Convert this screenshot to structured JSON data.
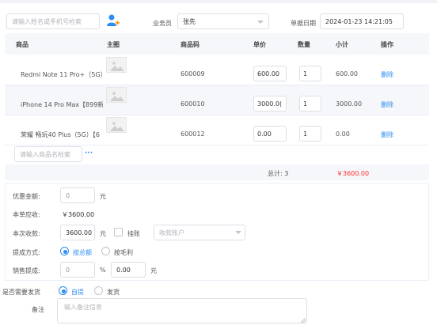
{
  "search": {
    "placeholder": "请输入姓名或手机号检索"
  },
  "header": {
    "salesperson_label": "业务员",
    "salesperson_value": "张先",
    "date_label": "单据日期",
    "date_value": "2024-01-23 14:21:05"
  },
  "table": {
    "columns": [
      "商品",
      "主图",
      "商品码",
      "单价",
      "数量",
      "小计",
      "操作"
    ],
    "rows": [
      {
        "name": "Redmi Note 11 Pro+（5G）",
        "code": "600009",
        "price": "600.00",
        "qty": "1",
        "subtotal": "600.00",
        "action": "删除"
      },
      {
        "name": "iPhone 14 Pro Max【899新",
        "code": "600010",
        "price": "3000.0(",
        "qty": "1",
        "subtotal": "3000.00",
        "action": "删除"
      },
      {
        "name": "荣耀 畅玩40 Plus（5G）【6",
        "code": "600012",
        "price": "0.00",
        "qty": "1",
        "subtotal": "0.00",
        "action": "删除"
      }
    ],
    "add_placeholder": "请输入商品名检索",
    "more": "···",
    "total_label": "总计: 3",
    "total_amount": "￥3600.00"
  },
  "form": {
    "discount_label": "优惠金额:",
    "discount_value": "0",
    "unit_yuan": "元",
    "receivable_label": "本单应收:",
    "receivable_value": "￥3600.00",
    "received_label": "本次收款:",
    "received_value": "3600.00",
    "hang_label": "挂账",
    "account_placeholder": "收款账户",
    "commission_method_label": "提成方式:",
    "commission_options": [
      "按总额",
      "按毛利"
    ],
    "sales_commission_label": "销售提成:",
    "commission_rate": "0",
    "percent": "%",
    "commission_amount": "0.00",
    "ship_label": "是否需要发货",
    "ship_options": [
      "自提",
      "发货"
    ],
    "remark_label": "备注",
    "remark_placeholder": "输入备注信息"
  },
  "colors": {
    "accent": "#2d8cf0",
    "danger": "#ff2d2d",
    "header_bg": "#f5f7fa"
  }
}
